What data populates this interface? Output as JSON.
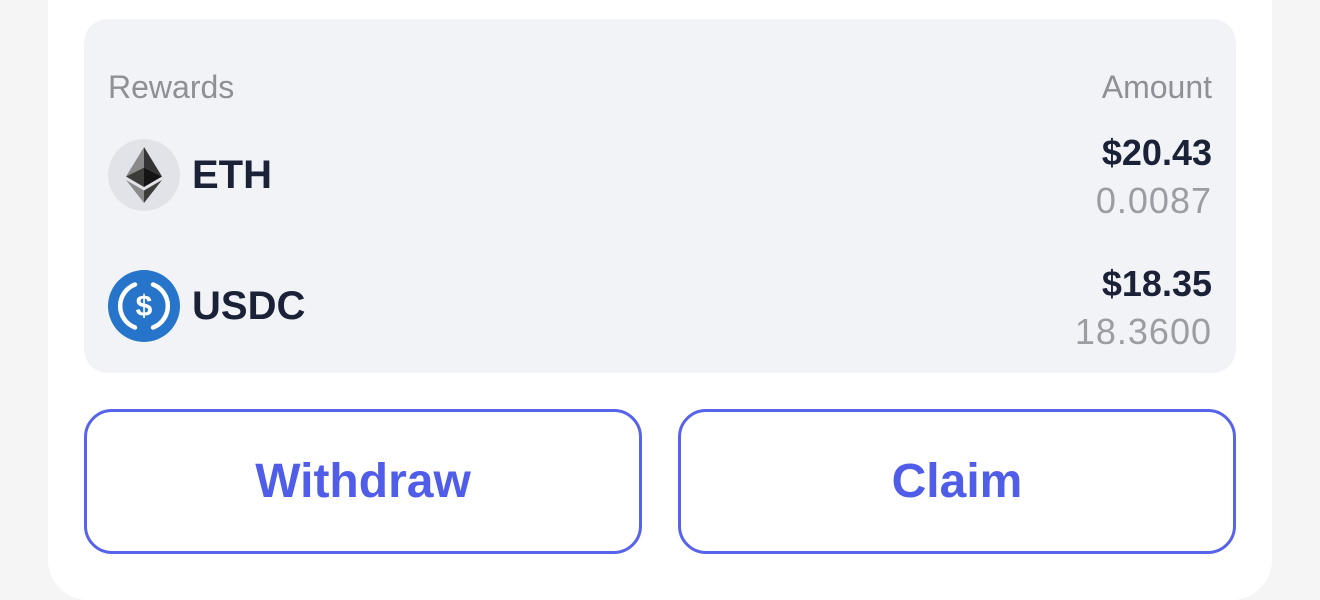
{
  "rewards_table": {
    "header_left": "Rewards",
    "header_right": "Amount",
    "rows": [
      {
        "token": "ETH",
        "icon": "ethereum-icon",
        "usd_value": "$20.43",
        "amount": "0.0087"
      },
      {
        "token": "USDC",
        "icon": "usdc-icon",
        "usd_value": "$18.35",
        "amount": "18.3600"
      }
    ]
  },
  "actions": {
    "withdraw_label": "Withdraw",
    "claim_label": "Claim"
  },
  "colors": {
    "accent": "#5763ea",
    "panel_bg": "#f2f3f7",
    "text_primary": "#1b2238",
    "text_secondary": "#9b9da3",
    "usdc_blue": "#2775ca"
  }
}
